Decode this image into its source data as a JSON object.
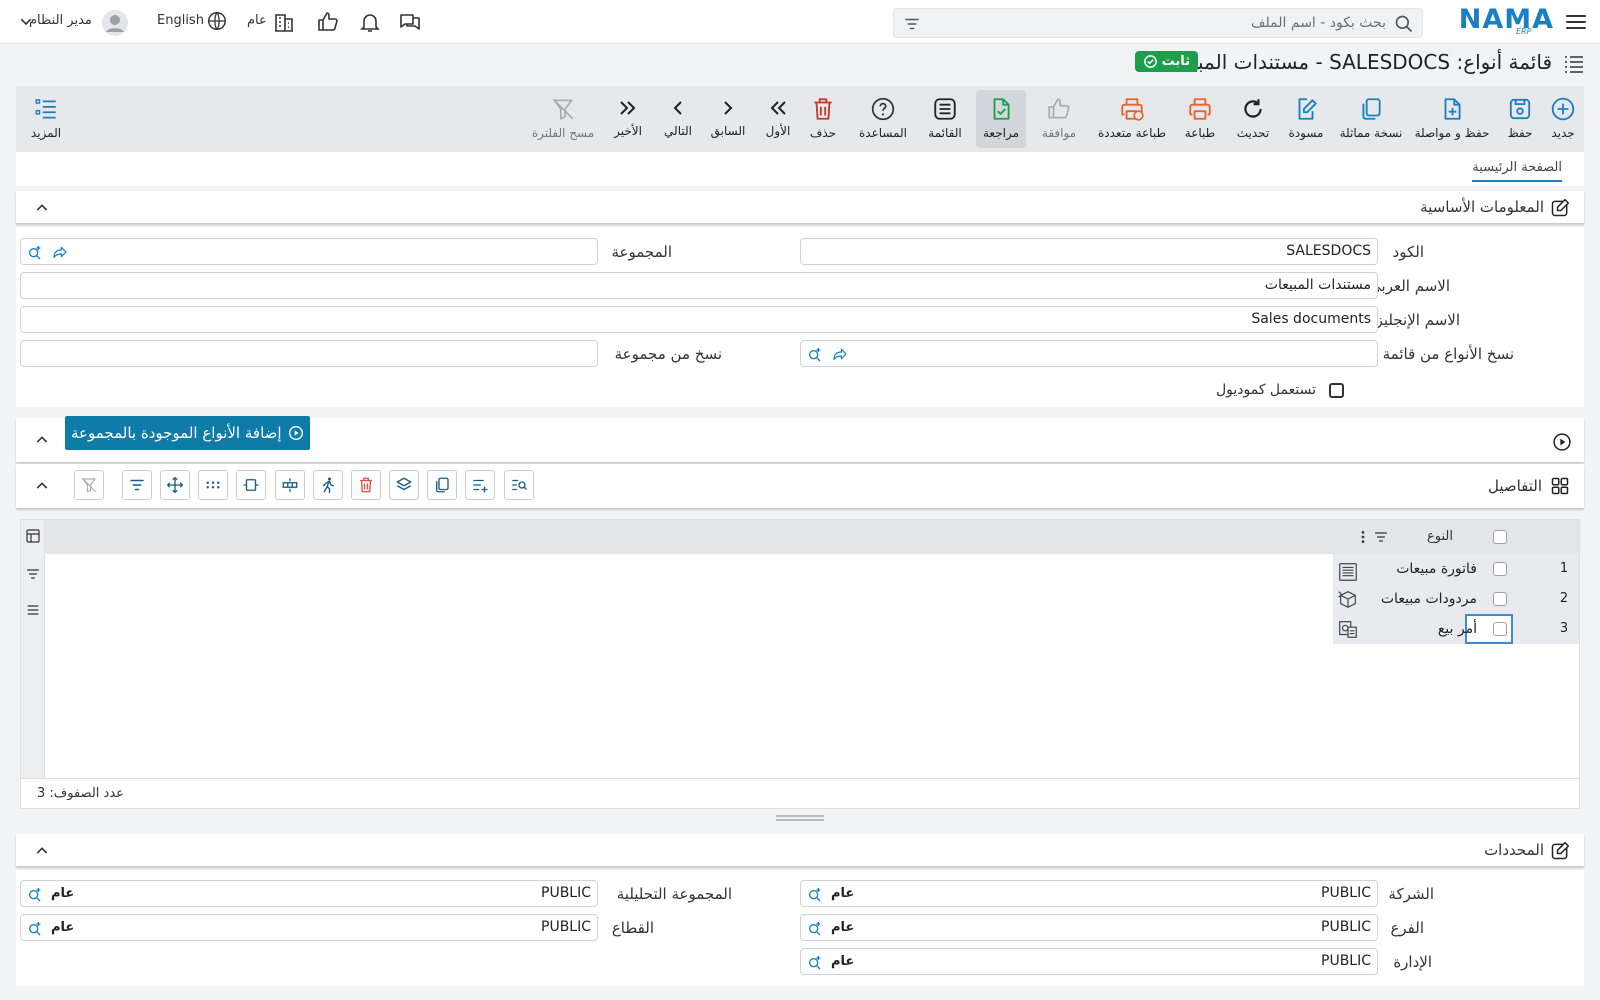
{
  "topbar": {
    "logo_text": "NAMA",
    "logo_sub": "ERP",
    "search_placeholder": "بحث بكود - اسم الملف",
    "user_label": "مدير النظام",
    "language_label": "English",
    "company_label": "عام"
  },
  "page": {
    "title": "قائمة أنواع: SALESDOCS - مستندات المبيعات",
    "status_badge": "ثابت"
  },
  "toolbar": {
    "new": "جديد",
    "save": "حفظ",
    "save_continue": "حفظ و مواصلة",
    "duplicate": "نسخة مماثلة",
    "draft": "مسودة",
    "refresh": "تحديث",
    "print": "طباعة",
    "multi_print": "طباعة متعددة",
    "approve": "موافقة",
    "review": "مراجعة",
    "list": "القائمة",
    "help": "المساعدة",
    "delete": "حذف",
    "first": "الأول",
    "previous": "السابق",
    "next": "التالي",
    "last": "الأخير",
    "clear_filter": "مسح الفلترة",
    "more": "المزيد"
  },
  "tabs": {
    "main": "الصفحة الرئيسية"
  },
  "basic_info": {
    "title": "المعلومات الأساسية",
    "code_label": "الكود",
    "code_value": "SALESDOCS",
    "group_label": "المجموعة",
    "group_value": "",
    "arabic_name_label": "الاسم العربي",
    "arabic_name_value": "مستندات المبيعات",
    "english_name_label": "الاسم الإنجليزي",
    "english_name_value": "Sales documents",
    "copy_from_list_label": "نسخ الأنواع من قائمة",
    "copy_from_group_label": "نسخ من مجموعة",
    "use_comodule_label": "تستعمل كموديول",
    "use_comodule_checked": false
  },
  "action_section": {
    "add_button": "إضافة الأنواع الموجودة بالمجموعة"
  },
  "details": {
    "title": "التفاصيل",
    "column_type": "النوع",
    "rows": [
      {
        "num": "1",
        "name": "فاتورة مبيعات"
      },
      {
        "num": "2",
        "name": "مردودات مبيعات"
      },
      {
        "num": "3",
        "name": "أمر بيع"
      }
    ],
    "row_count_label": "عدد الصفوف: 3"
  },
  "dimensions": {
    "title": "المحددات",
    "company_label": "الشركة",
    "company_value": "PUBLIC",
    "company_tag": "عام",
    "analytic_group_label": "المجموعة التحليلية",
    "analytic_group_value": "PUBLIC",
    "analytic_group_tag": "عام",
    "branch_label": "الفرع",
    "branch_value": "PUBLIC",
    "branch_tag": "عام",
    "sector_label": "القطاع",
    "sector_value": "PUBLIC",
    "sector_tag": "عام",
    "department_label": "الإدارة",
    "department_value": "PUBLIC",
    "department_tag": "عام"
  },
  "colors": {
    "brand": "#1a7fc1",
    "badge_green": "#1e9e4a",
    "action_teal": "#0f7ca8",
    "print_orange": "#e8622a",
    "delete_red": "#c0392b"
  }
}
